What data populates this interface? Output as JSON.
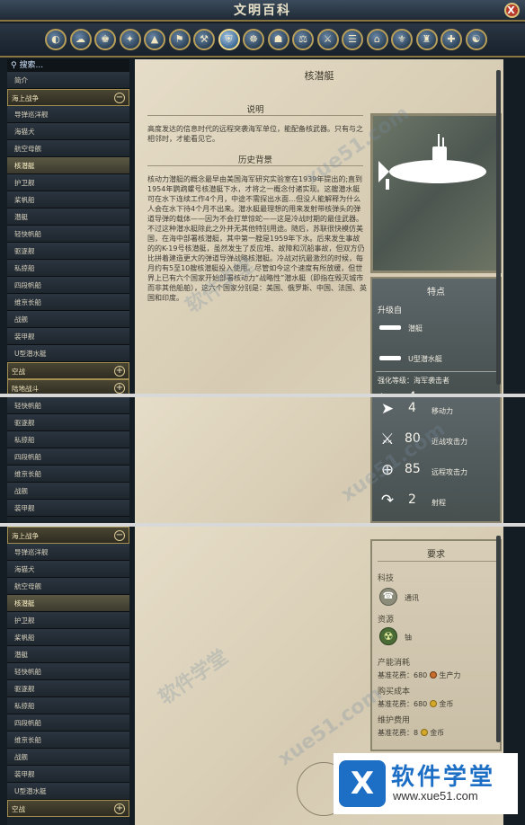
{
  "window": {
    "title": "文明百科",
    "close": "X"
  },
  "categories": [
    "◐",
    "☁",
    "♚",
    "✦",
    "▲",
    "⚑",
    "⚒",
    "⛨",
    "☸",
    "☗",
    "⚖",
    "⚔",
    "☰",
    "⌂",
    "⚜",
    "♜",
    "✚",
    "☯"
  ],
  "search": {
    "placeholder": "搜索..."
  },
  "sidebar_p1": [
    {
      "label": "简介",
      "kind": "item"
    },
    {
      "label": "海上战争",
      "kind": "header",
      "toggle": "−"
    },
    {
      "label": "导弹巡洋舰",
      "kind": "item"
    },
    {
      "label": "海猫犬",
      "kind": "item"
    },
    {
      "label": "航空母舰",
      "kind": "item"
    },
    {
      "label": "核潜艇",
      "kind": "selected"
    },
    {
      "label": "护卫舰",
      "kind": "item"
    },
    {
      "label": "桨帆船",
      "kind": "item"
    },
    {
      "label": "潜艇",
      "kind": "item"
    },
    {
      "label": "轻快帆船",
      "kind": "item"
    },
    {
      "label": "驱逐舰",
      "kind": "item"
    },
    {
      "label": "私掠船",
      "kind": "item"
    },
    {
      "label": "四段帆船",
      "kind": "item"
    },
    {
      "label": "维京长船",
      "kind": "item"
    },
    {
      "label": "战舰",
      "kind": "item"
    },
    {
      "label": "装甲舰",
      "kind": "item"
    },
    {
      "label": "U型潜水艇",
      "kind": "item"
    },
    {
      "label": "空战",
      "kind": "header",
      "toggle": "+"
    },
    {
      "label": "陆地战斗",
      "kind": "header",
      "toggle": "+"
    }
  ],
  "sidebar_p2": [
    "轻快帆船",
    "驱逐舰",
    "私掠船",
    "四段帆船",
    "维京长船",
    "战舰",
    "装甲舰"
  ],
  "sidebar_p3": [
    {
      "label": "海上战争",
      "kind": "header",
      "toggle": "−"
    },
    {
      "label": "导弹巡洋舰",
      "kind": "item"
    },
    {
      "label": "海猫犬",
      "kind": "item"
    },
    {
      "label": "航空母舰",
      "kind": "item"
    },
    {
      "label": "核潜艇",
      "kind": "selected"
    },
    {
      "label": "护卫舰",
      "kind": "item"
    },
    {
      "label": "桨帆船",
      "kind": "item"
    },
    {
      "label": "潜艇",
      "kind": "item"
    },
    {
      "label": "轻快帆船",
      "kind": "item"
    },
    {
      "label": "驱逐舰",
      "kind": "item"
    },
    {
      "label": "私掠船",
      "kind": "item"
    },
    {
      "label": "四段帆船",
      "kind": "item"
    },
    {
      "label": "维京长船",
      "kind": "item"
    },
    {
      "label": "战舰",
      "kind": "item"
    },
    {
      "label": "装甲舰",
      "kind": "item"
    },
    {
      "label": "U型潜水艇",
      "kind": "item"
    },
    {
      "label": "空战",
      "kind": "header",
      "toggle": "+"
    }
  ],
  "article": {
    "title": "核潜艇",
    "desc_title": "说明",
    "desc": "高度发达的信息时代的远程突袭海军单位，能配备核武器。只有与之相邻时，才能看见它。",
    "history_title": "历史背景",
    "history": "核动力潜艇的概念最早由美国海军研究实验室在1939年提出的;直到1954年鹦鹉螺号核潜艇下水，才将之一概念付诸实现。这艘潜水艇可在水下连续工作4个月，中途不需探出水面…但没人能解释为什么人会在水下待4个月不出来。潜水艇最理想的用来发射带核弹头的弹道导弹的载体——因为不会打草惊蛇——这是冷战时期的最佳武器。不过这种潜水艇除此之外并无其他特别用途。随后，苏联很快模仿美国，在海中部署核潜艇，其中第一艘是1959年下水。后来发生事故的的K-19号核潜艇，虽然发生了反应堆、故障和沉船事故，但双方仍比拼着建造更大的弹道导弹战略核潜艇。冷战对抗最激烈的时候，每月约有5至10艘核潜艇投入使用。尽管如今这个速度有所放缓，但世界上已有六个国家开始部署核动力“战略性”潜水艇（即指在毁灭城市而非其他船舶），这六个国家分别是：美国、俄罗斯、中国、法国、英国和印度。"
  },
  "stats": {
    "title": "特点",
    "upgrade_from": "升级自",
    "upgrade_units": [
      "潜艇",
      "U型潜水艇"
    ],
    "promotion_level": "强化等级：海军袭击者",
    "move_value": "4",
    "move_label": "移动力",
    "melee_value": "80",
    "melee_label": "近战攻击力",
    "ranged_value": "85",
    "ranged_label": "远程攻击力",
    "range_value": "2",
    "range_label": "射程"
  },
  "requirements": {
    "title": "要求",
    "tech_label": "科技",
    "tech": "通讯",
    "resource_label": "资源",
    "resource": "铀",
    "prod_label": "产能消耗",
    "prod_text": "基准花费：680",
    "prod_unit": "生产力",
    "buy_label": "购买成本",
    "buy_text": "基准花费：680",
    "buy_unit": "金币",
    "maint_label": "维护费用",
    "maint_text": "基准花费：8",
    "maint_unit": "金币"
  },
  "watermark": {
    "cn": "软件学堂",
    "url": "xue51.com"
  },
  "logo": {
    "icon": "X",
    "cn": "软件学堂",
    "url": "www.xue51.com"
  }
}
